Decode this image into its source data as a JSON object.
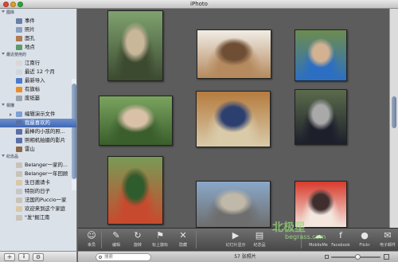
{
  "window": {
    "title": "iPhoto"
  },
  "sidebar": {
    "library_header": "图库",
    "library": [
      {
        "label": "事件",
        "icon": "events-icon",
        "color": "#6a7fa8"
      },
      {
        "label": "照片",
        "icon": "photos-icon",
        "color": "#8aa0c2"
      },
      {
        "label": "面孔",
        "icon": "faces-icon",
        "color": "#b07a52"
      },
      {
        "label": "地点",
        "icon": "places-icon",
        "color": "#5c9b6a"
      }
    ],
    "recent_header": "最近使用的",
    "recent": [
      {
        "label": "江南行",
        "icon": "event-icon",
        "color": "#d8d8d8"
      },
      {
        "label": "最近 12 个月",
        "icon": "calendar-icon",
        "color": "#d0d6de"
      },
      {
        "label": "最新导入",
        "icon": "import-icon",
        "color": "#4c7ac9"
      },
      {
        "label": "有旗标",
        "icon": "flag-icon",
        "color": "#e88d2a"
      },
      {
        "label": "废纸篓",
        "icon": "trash-icon",
        "color": "#9aa3ad"
      }
    ],
    "albums_header": "相簿",
    "albums": [
      {
        "label": "编辑演示文件",
        "icon": "folder-icon",
        "color": "#7d9fd1",
        "disclosure": true,
        "selected": false
      },
      {
        "label": "我最喜欢的",
        "icon": "smart-album-icon",
        "color": "#5a6fa8",
        "selected": true
      },
      {
        "label": "最棒的小孩的照...",
        "icon": "smart-album-icon",
        "color": "#5a6fa8",
        "selected": false
      },
      {
        "label": "照相机拍摄的影片",
        "icon": "smart-album-icon",
        "color": "#5a6fa8",
        "selected": false
      },
      {
        "label": "雷山",
        "icon": "album-icon",
        "color": "#8a6a4a",
        "selected": false
      }
    ],
    "keepsakes_header": "纪念品",
    "keepsakes": [
      {
        "label": "Belanger一家的...",
        "icon": "book-icon",
        "color": "#c9c2b6"
      },
      {
        "label": "Belanger一年回顾",
        "icon": "book-icon",
        "color": "#c9c2b6"
      },
      {
        "label": "生日邀请卡",
        "icon": "card-icon",
        "color": "#d8c8a8"
      },
      {
        "label": "特别的日子",
        "icon": "calendar-book-icon",
        "color": "#c7c7c7"
      },
      {
        "label": "法国的Puccio一家",
        "icon": "book-icon",
        "color": "#c9c2b6"
      },
      {
        "label": "欢迎来到这个家庭",
        "icon": "card-icon",
        "color": "#d8c8a8"
      },
      {
        "label": "\"发\"掘江南",
        "icon": "book-icon",
        "color": "#c9c2b6"
      }
    ],
    "footer": {
      "add": "+",
      "info": "i",
      "gear": "⚙"
    }
  },
  "photos": [
    {
      "name": "photo-boy-striped-shirt",
      "colors": [
        "#7fa26f",
        "#3c4a30",
        "#c9b79a"
      ]
    },
    {
      "name": "photo-crabs-on-plate",
      "colors": [
        "#f1ede6",
        "#b58a5e",
        "#6e4e35"
      ]
    },
    {
      "name": "photo-boy-blue-cap",
      "colors": [
        "#6d8c4f",
        "#2c6fc2",
        "#d2b290"
      ]
    },
    {
      "name": "photo-family-by-trees",
      "colors": [
        "#7aa35f",
        "#3a5e2c",
        "#d9c1a8"
      ]
    },
    {
      "name": "photo-family-in-car",
      "colors": [
        "#b57b3f",
        "#d9caa8",
        "#2d3f6e"
      ]
    },
    {
      "name": "photo-on-park-bench",
      "colors": [
        "#5b6b4c",
        "#1d1f2b",
        "#a9a9a9"
      ]
    },
    {
      "name": "photo-couple-in-garden",
      "colors": [
        "#789b55",
        "#c84a2e",
        "#2f5c2c"
      ]
    },
    {
      "name": "photo-father-and-son",
      "colors": [
        "#8aa8c9",
        "#6e6e6e",
        "#c0b9a9"
      ]
    },
    {
      "name": "photo-dragon-mask",
      "colors": [
        "#d83a2c",
        "#f3e7de",
        "#3f2e2e"
      ]
    }
  ],
  "toolbar": {
    "buttons": [
      {
        "label": "幸员",
        "icon": "person-icon"
      },
      {
        "label": "编辑",
        "icon": "pencil-icon"
      },
      {
        "label": "旋转",
        "icon": "rotate-icon"
      },
      {
        "label": "标上旗标",
        "icon": "flag-icon"
      },
      {
        "label": "隐藏",
        "icon": "x-hide-icon"
      },
      {
        "label": "幻灯片显示",
        "icon": "play-icon"
      },
      {
        "label": "纪念品",
        "icon": "keepsake-icon"
      },
      {
        "label": "MobileMe",
        "icon": "mobileme-icon"
      },
      {
        "label": "Facebook",
        "icon": "facebook-icon"
      },
      {
        "label": "Flickr",
        "icon": "flickr-icon"
      },
      {
        "label": "电子邮件",
        "icon": "email-icon"
      }
    ]
  },
  "statusbar": {
    "search_placeholder": "搜索",
    "count": "57 张照片"
  },
  "watermark": {
    "line1": "北极星",
    "line2": "begrass.com"
  }
}
